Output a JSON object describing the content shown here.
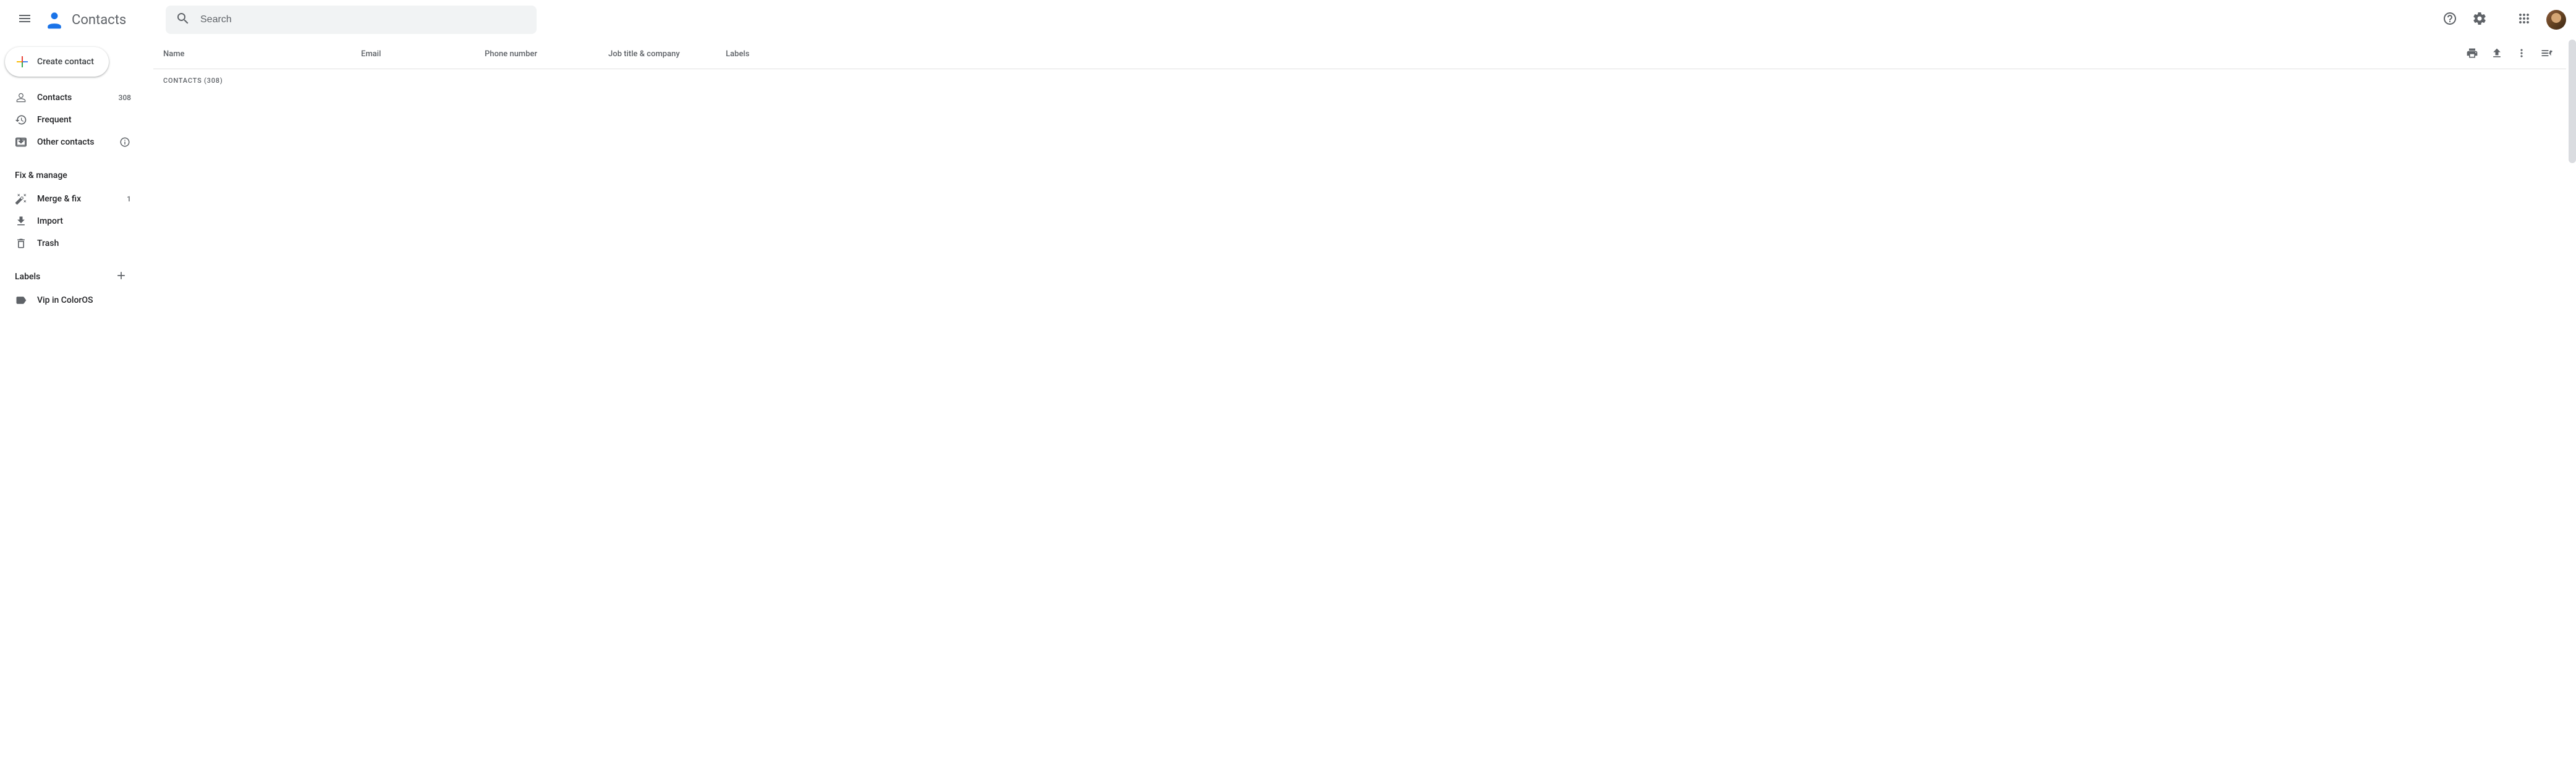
{
  "header": {
    "app_title": "Contacts",
    "search_placeholder": "Search"
  },
  "sidebar": {
    "create_label": "Create contact",
    "primary": [
      {
        "icon": "person-icon",
        "label": "Contacts",
        "count": "308"
      },
      {
        "icon": "history-icon",
        "label": "Frequent",
        "count": ""
      },
      {
        "icon": "archive-icon",
        "label": "Other contacts",
        "count": "",
        "info": true
      }
    ],
    "fix_section_title": "Fix & manage",
    "fix_items": [
      {
        "icon": "wand-icon",
        "label": "Merge & fix",
        "count": "1"
      },
      {
        "icon": "download-icon",
        "label": "Import",
        "count": ""
      },
      {
        "icon": "trash-icon",
        "label": "Trash",
        "count": ""
      }
    ],
    "labels_section_title": "Labels",
    "label_items": [
      {
        "icon": "label-icon",
        "label": "Vip in ColorOS"
      }
    ]
  },
  "table": {
    "columns": {
      "name": "Name",
      "email": "Email",
      "phone": "Phone number",
      "job": "Job title & company",
      "labels": "Labels"
    },
    "section_label": "CONTACTS (308)"
  }
}
